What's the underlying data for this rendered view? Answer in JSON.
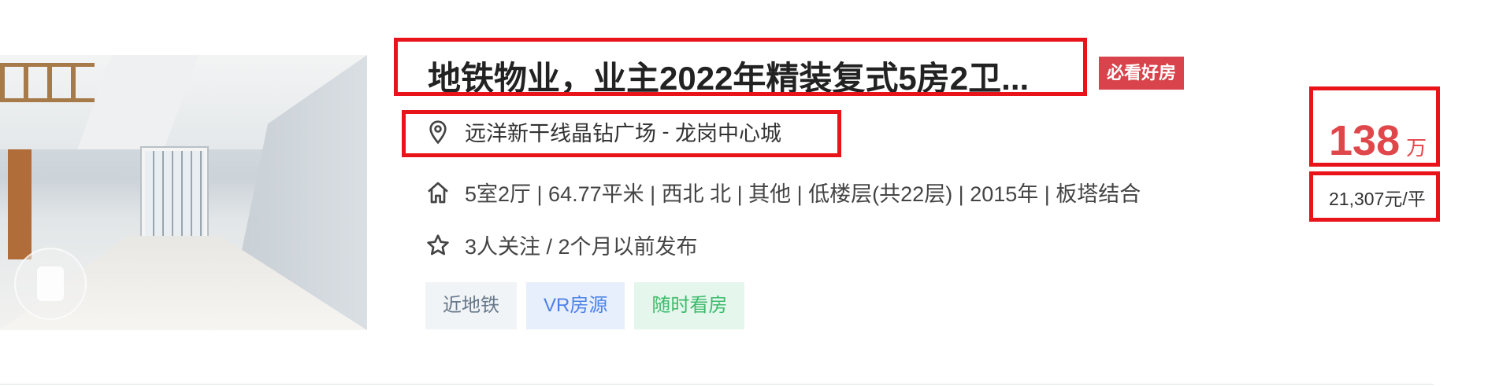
{
  "listing": {
    "title": "地铁物业，业主2022年精装复式5房2卫...",
    "badge": "必看好房",
    "location": {
      "icon": "location-pin-icon",
      "community": "远洋新干线晶钻广场",
      "separator": " - ",
      "district": "龙岗中心城"
    },
    "info": {
      "icon": "house-icon",
      "text": "5室2厅 | 64.77平米 | 西北 北 | 其他 | 低楼层(共22层) | 2015年 | 板塔结合"
    },
    "follow": {
      "icon": "star-icon",
      "text": "3人关注 / 2个月以前发布"
    },
    "tags": [
      "近地铁",
      "VR房源",
      "随时看房"
    ],
    "price": {
      "total": "138",
      "unit": "万",
      "per_sqm": "21,307元/平"
    },
    "photo": {
      "vr_badge_icon": "vr-panorama-icon"
    }
  },
  "colors": {
    "price": "#e0474b",
    "badge_bg": "#d9434b",
    "highlight_box": "#e8141a",
    "tag_subway": "#67788a",
    "tag_vr": "#4c82e8",
    "tag_visit": "#3dbb6b"
  }
}
